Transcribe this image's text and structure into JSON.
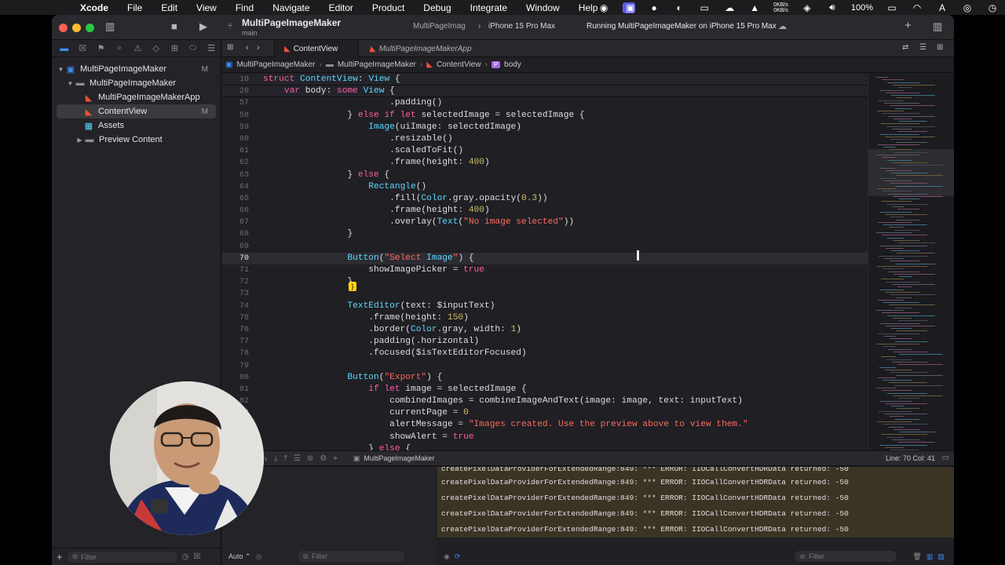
{
  "menubar": {
    "app_name": "Xcode",
    "items": [
      "File",
      "Edit",
      "View",
      "Find",
      "Navigate",
      "Editor",
      "Product",
      "Debug",
      "Integrate",
      "Window",
      "Help"
    ],
    "net_up": "0KB/s",
    "net_down": "0KB/s",
    "battery": "100%"
  },
  "toolbar": {
    "project_title": "MultiPageImageMaker",
    "branch": "main",
    "scheme": "MultiPageImag",
    "device": "iPhone 15 Pro Max",
    "run_status": "Running MultiPageImageMaker on iPhone 15 Pro Max"
  },
  "navigator": {
    "items": [
      {
        "label": "MultiPageImageMaker",
        "badge": "M"
      },
      {
        "label": "MultiPageImageMaker",
        "badge": ""
      },
      {
        "label": "MultiPageImageMakerApp",
        "badge": ""
      },
      {
        "label": "ContentView",
        "badge": "M"
      },
      {
        "label": "Assets",
        "badge": ""
      },
      {
        "label": "Preview Content",
        "badge": ""
      }
    ],
    "filter_placeholder": "Filter"
  },
  "tabs": [
    {
      "label": "ContentView"
    },
    {
      "label": "MultiPageImageMakerApp"
    }
  ],
  "jumpbar": [
    "MultiPageImageMaker",
    "MultiPageImageMaker",
    "ContentView",
    "body"
  ],
  "code": {
    "sticky": [
      {
        "n": "10",
        "t": "struct ContentView: View {"
      },
      {
        "n": "20",
        "t": "    var body: some View {"
      }
    ],
    "lines": [
      {
        "n": "57",
        "t": "                        .padding()"
      },
      {
        "n": "58",
        "t": "                } else if let selectedImage = selectedImage {"
      },
      {
        "n": "59",
        "t": "                    Image(uiImage: selectedImage)"
      },
      {
        "n": "60",
        "t": "                        .resizable()"
      },
      {
        "n": "61",
        "t": "                        .scaledToFit()"
      },
      {
        "n": "62",
        "t": "                        .frame(height: 400)"
      },
      {
        "n": "63",
        "t": "                } else {"
      },
      {
        "n": "64",
        "t": "                    Rectangle()"
      },
      {
        "n": "65",
        "t": "                        .fill(Color.gray.opacity(0.3))"
      },
      {
        "n": "66",
        "t": "                        .frame(height: 400)"
      },
      {
        "n": "67",
        "t": "                        .overlay(Text(\"No image selected\"))"
      },
      {
        "n": "68",
        "t": "                }"
      },
      {
        "n": "69",
        "t": ""
      },
      {
        "n": "70",
        "t": "                Button(\"Select Image\") {"
      },
      {
        "n": "71",
        "t": "                    showImagePicker = true"
      },
      {
        "n": "72",
        "t": "                }"
      },
      {
        "n": "73",
        "t": ""
      },
      {
        "n": "74",
        "t": "                TextEditor(text: $inputText)"
      },
      {
        "n": "75",
        "t": "                    .frame(height: 150)"
      },
      {
        "n": "76",
        "t": "                    .border(Color.gray, width: 1)"
      },
      {
        "n": "77",
        "t": "                    .padding(.horizontal)"
      },
      {
        "n": "78",
        "t": "                    .focused($isTextEditorFocused)"
      },
      {
        "n": "79",
        "t": ""
      },
      {
        "n": "80",
        "t": "                Button(\"Export\") {"
      },
      {
        "n": "81",
        "t": "                    if let image = selectedImage {"
      },
      {
        "n": "82",
        "t": "                        combinedImages = combineImageAndText(image: image, text: inputText)"
      },
      {
        "n": "83",
        "t": "                        currentPage = 0"
      },
      {
        "n": "84",
        "t": "                        alertMessage = \"Images created. Use the preview above to view them.\""
      },
      {
        "n": "85",
        "t": "                        showAlert = true"
      },
      {
        "n": "86",
        "t": "                    } else {"
      }
    ],
    "current_line": "70"
  },
  "debugbar": {
    "target": "MultiPageImageMaker",
    "cursor_pos": "Line: 70  Col: 41"
  },
  "console": {
    "lines": [
      "createPixelDataProviderForExtendedRange:849: *** ERROR: IIOCallConvertHDRData returned: -50",
      "createPixelDataProviderForExtendedRange:849: *** ERROR: IIOCallConvertHDRData returned: -50",
      "createPixelDataProviderForExtendedRange:849: *** ERROR: IIOCallConvertHDRData returned: -50",
      "createPixelDataProviderForExtendedRange:849: *** ERROR: IIOCallConvertHDRData returned: -50",
      "createPixelDataProviderForExtendedRange:849: *** ERROR: IIOCallConvertHDRData returned: -50"
    ],
    "auto_label": "Auto",
    "filter_placeholder": "Filter"
  },
  "colors": {
    "accent": "#3b8ef7",
    "keyword": "#fc5fa3",
    "string": "#fc6a5d",
    "number": "#d0bf69"
  }
}
